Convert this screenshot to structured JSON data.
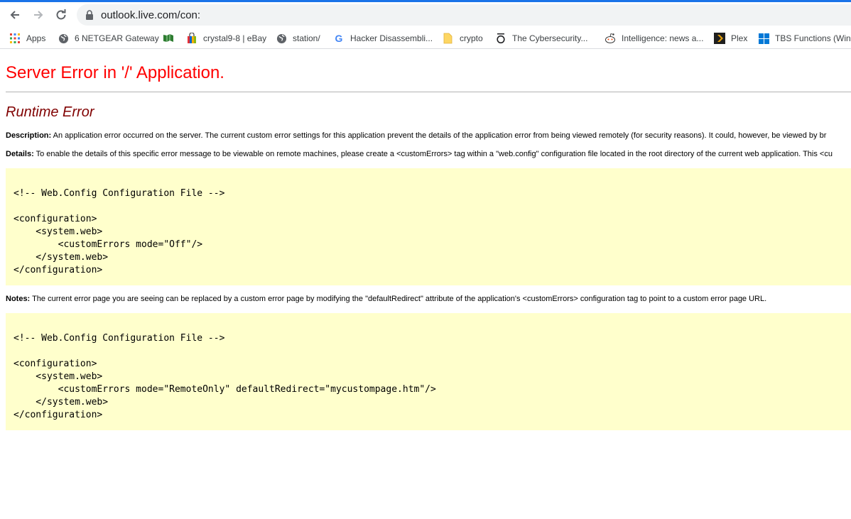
{
  "browser": {
    "url": "outlook.live.com/con:",
    "bookmarks": [
      {
        "label": "Apps",
        "icon": "apps-grid-icon"
      },
      {
        "label": "6 NETGEAR Gateway",
        "icon": "globe-icon"
      },
      {
        "label": "",
        "icon": "map-icon"
      },
      {
        "label": "crystal9-8 | eBay",
        "icon": "shopping-bag-icon"
      },
      {
        "label": "station/",
        "icon": "globe-icon"
      },
      {
        "label": "Hacker Disassembli...",
        "icon": "google-icon"
      },
      {
        "label": "crypto",
        "icon": "folder-icon"
      },
      {
        "label": "The Cybersecurity...",
        "icon": "o-logo-icon"
      },
      {
        "label": "Intelligence: news a...",
        "icon": "reddit-icon"
      },
      {
        "label": "Plex",
        "icon": "plex-icon"
      },
      {
        "label": "TBS Functions (Win...",
        "icon": "windows-icon"
      }
    ]
  },
  "page": {
    "title": "Server Error in '/' Application.",
    "subtitle": "Runtime Error",
    "description_label": "Description:",
    "description_text": " An application error occurred on the server. The current custom error settings for this application prevent the details of the application error from being viewed remotely (for security reasons). It could, however, be viewed by br",
    "details_label": "Details:",
    "details_text": " To enable the details of this specific error message to be viewable on remote machines, please create a <customErrors> tag within a \"web.config\" configuration file located in the root directory of the current web application. This <cu",
    "code1": "\n<!-- Web.Config Configuration File -->\n\n<configuration>\n    <system.web>\n        <customErrors mode=\"Off\"/>\n    </system.web>\n</configuration>",
    "notes_label": "Notes:",
    "notes_text": " The current error page you are seeing can be replaced by a custom error page by modifying the \"defaultRedirect\" attribute of the application's <customErrors> configuration tag to point to a custom error page URL.",
    "code2": "\n<!-- Web.Config Configuration File -->\n\n<configuration>\n    <system.web>\n        <customErrors mode=\"RemoteOnly\" defaultRedirect=\"mycustompage.htm\"/>\n    </system.web>\n</configuration>"
  },
  "colors": {
    "title": "#ff0000",
    "subtitle": "#800000",
    "code_bg": "#ffffcc",
    "accent": "#1a73e8"
  }
}
